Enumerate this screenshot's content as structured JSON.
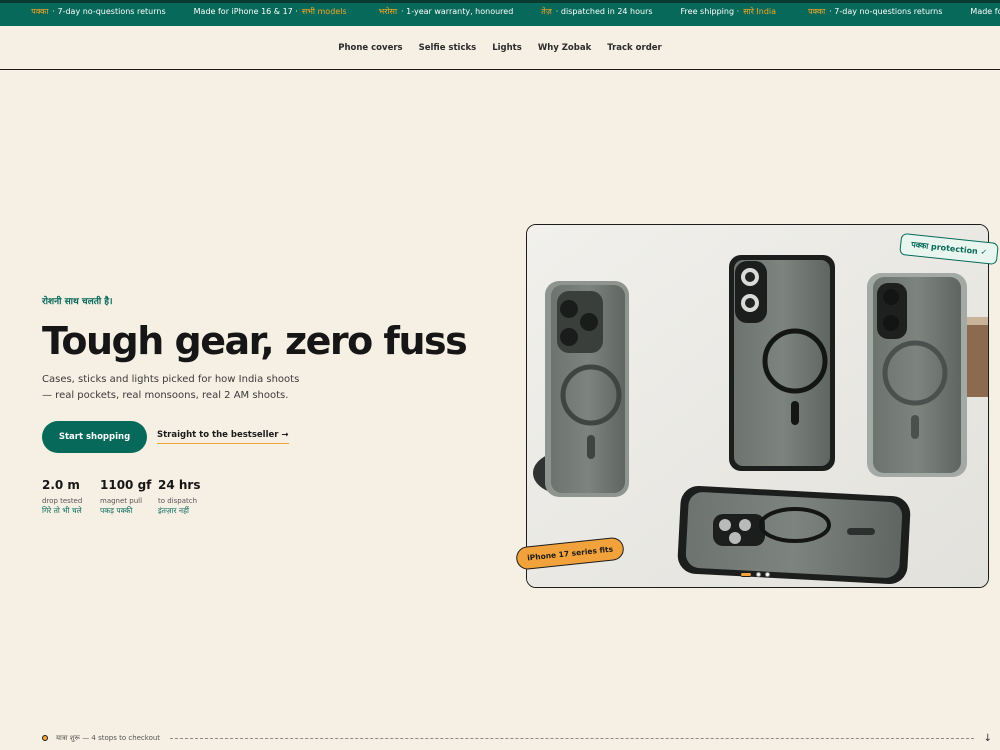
{
  "ticker": [
    {
      "hi": "",
      "text": ""
    },
    {
      "hi": "पक्का",
      "text": "· 7-day no-questions returns"
    },
    {
      "pre": "Made for iPhone 16 & 17 ·",
      "hi": "सभी models",
      "text": ""
    },
    {
      "hi": "भरोसा",
      "text": "· 1-year warranty, honoured"
    },
    {
      "hi": "तेज़",
      "text": "· dispatched in 24 hours"
    },
    {
      "pre": "Free shipping ·",
      "hi": "सारे India",
      "text": ""
    },
    {
      "hi": "पक्का",
      "text": "· 7-day no-questions returns"
    },
    {
      "pre": "Made for iPhone 16 & 17 ·",
      "hi": "सभी models",
      "text": ""
    }
  ],
  "ticker_first": "ndia",
  "nav": {
    "items": [
      "Phone covers",
      "Selfie sticks",
      "Lights",
      "Why Zobak",
      "Track order"
    ]
  },
  "hero": {
    "kicker": "रोशनी साथ चलती है।",
    "headline_main": "Tough gear, zero ",
    "headline_highlight": "fuss",
    "subtitle": "Cases, sticks and lights picked for how India shoots — real pockets, real monsoons, real 2 AM shoots.",
    "cta_primary": "Start shopping",
    "cta_secondary": "Straight to the bestseller →",
    "stats": [
      {
        "value": "2.0 m",
        "label": "drop tested",
        "hindi": "गिरे तो भी चले"
      },
      {
        "value": "1100 gf",
        "label": "magnet pull",
        "hindi": "पकड़ पक्की"
      },
      {
        "value": "24 hrs",
        "label": "to dispatch",
        "hindi": "इंतज़ार नहीं"
      }
    ]
  },
  "gallery": {
    "badge_top": "पक्का protection ✓",
    "badge_bottom": "iPhone 17 series fits",
    "slides_count": 3,
    "active_slide": 1
  },
  "progress": {
    "text": "यात्रा शुरू — 4 stops to checkout",
    "arrow": "↓"
  },
  "colors": {
    "brand_green": "#06695a",
    "accent_orange": "#f2a23a",
    "background": "#f6efe4"
  }
}
